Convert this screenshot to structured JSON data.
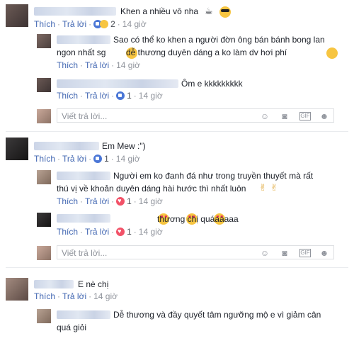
{
  "actions": {
    "like": "Thích",
    "reply": "Trả lời",
    "sep": "·"
  },
  "reply_placeholder": "Viết trả lời...",
  "comments": [
    {
      "text": "Khen a nhiều vô nha",
      "likes": "2",
      "time": "14 giờ"
    },
    {
      "text_line1": "Sao có thể ko khen a người đờn ông bán bánh bong lan",
      "text_line2": "ngon nhất sg",
      "text_line2_b": "dễ thương duyên dáng a ko làm dv hơi phí",
      "time": "14 giờ"
    },
    {
      "text": "Ôm e kkkkkkkkk",
      "likes": "1",
      "time": "14 giờ"
    },
    {
      "text": "Em Mew :\")",
      "likes": "1",
      "time": "14 giờ"
    },
    {
      "text_line1": "Người em ko đanh đá như trong truyền thuyết mà rất",
      "text_line2": "thú vị về khoản duyên dáng hài hước thì nhất luôn",
      "likes": "1",
      "time": "14 giờ"
    },
    {
      "text": "thương chị quáaaaaa",
      "likes": "1",
      "time": "14 giờ"
    },
    {
      "text": "E nè chị",
      "time": "14 giờ"
    },
    {
      "text_line1": "Dễ thương và đầy quyết tâm ngưỡng mộ e vì giảm cân",
      "text_line2": "quá giỏi"
    }
  ],
  "icons": [
    "emoji-icon",
    "camera-icon",
    "gif-icon",
    "sticker-icon"
  ],
  "colors": {
    "link": "#4267b2",
    "meta": "#90949c",
    "text": "#1d2129",
    "like": "#4a76d6",
    "love": "#f25268"
  }
}
